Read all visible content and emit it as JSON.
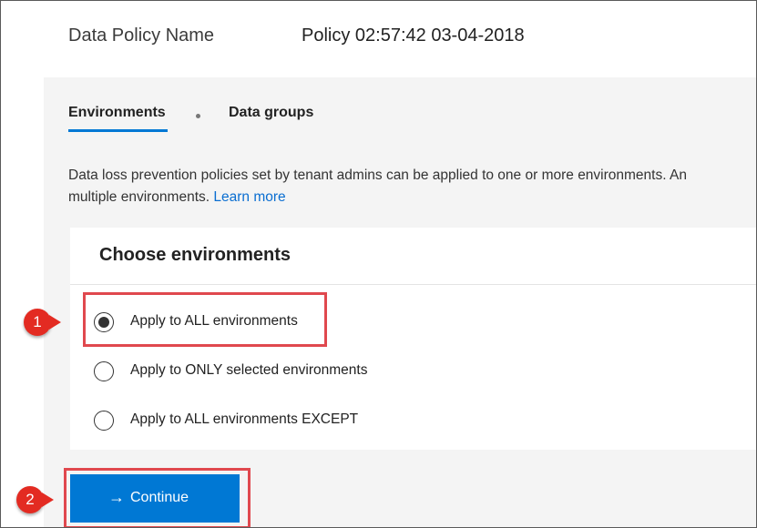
{
  "header": {
    "policy_name_label": "Data Policy Name",
    "policy_name_value": "Policy 02:57:42 03-04-2018"
  },
  "tabs": [
    {
      "label": "Environments",
      "active": true
    },
    {
      "label": "Data groups",
      "active": false
    }
  ],
  "description": {
    "line1": "Data loss prevention policies set by tenant admins can be applied to one or more environments. An",
    "line2": "multiple environments.",
    "link": "Learn more"
  },
  "choose": {
    "title": "Choose environments",
    "options": [
      {
        "label": "Apply to ALL environments",
        "selected": true
      },
      {
        "label": "Apply to ONLY selected environments",
        "selected": false
      },
      {
        "label": "Apply to ALL environments EXCEPT",
        "selected": false
      }
    ]
  },
  "continue_button": {
    "label": "Continue",
    "icon": "arrow-right-icon"
  },
  "callouts": [
    "1",
    "2"
  ],
  "colors": {
    "accent": "#0078d4",
    "callout": "#e32b22",
    "highlight_border": "#e0484e",
    "panel_background": "#f4f4f4"
  }
}
